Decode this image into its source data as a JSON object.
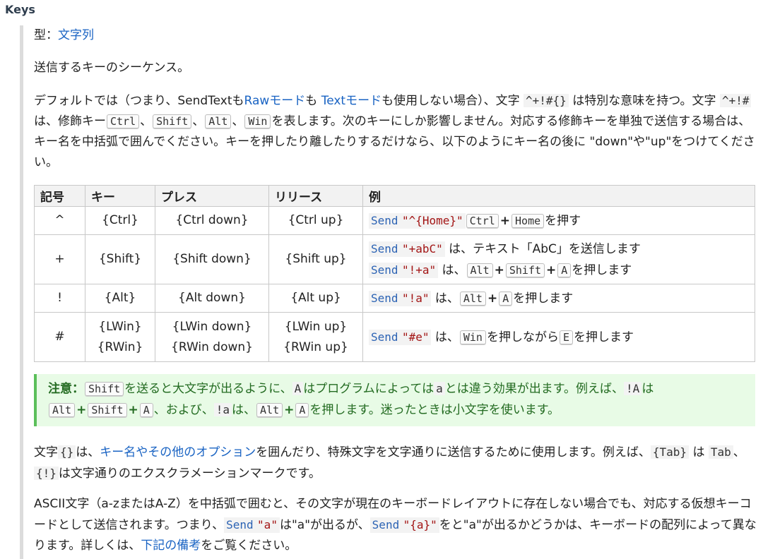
{
  "title": "Keys",
  "type_label": "型：",
  "type_value": "文字列",
  "description": "送信するキーのシーケンス。",
  "para1": {
    "t1": "デフォルトでは（つまり、SendTextも",
    "link_raw": "Rawモード",
    "t2": "も ",
    "link_text": "Textモード",
    "t3": "も使用しない場合）、文字 ",
    "code1": "^+!#{}",
    "t4": " は特別な意味を持つ。文字 ",
    "code2": "^+!#",
    "t5": " は、修飾キー",
    "k_ctrl": "Ctrl",
    "sep1": "、",
    "k_shift": "Shift",
    "sep2": "、",
    "k_alt": "Alt",
    "sep3": "、",
    "k_win": "Win",
    "t6": "を表します。次のキーにしか影響しません。対応する修飾キーを単独で送信する場合は、キー名を中括弧で囲んでください。キーを押したり離したりするだけなら、以下のようにキー名の後に \"down\"や\"up\"をつけてください。"
  },
  "table": {
    "headers": [
      "記号",
      "キー",
      "プレス",
      "リリース",
      "例"
    ],
    "rows": [
      {
        "sym": "^",
        "key": "{Ctrl}",
        "press": "{Ctrl down}",
        "release": "{Ctrl up}"
      },
      {
        "sym": "+",
        "key": "{Shift}",
        "press": "{Shift down}",
        "release": "{Shift up}"
      },
      {
        "sym": "!",
        "key": "{Alt}",
        "press": "{Alt down}",
        "release": "{Alt up}"
      },
      {
        "sym": "#",
        "key": "{LWin}",
        "key2": "{RWin}",
        "press": "{LWin down}",
        "press2": "{RWin down}",
        "release": "{LWin up}",
        "release2": "{RWin up}"
      }
    ],
    "ex_send": "Send",
    "ex1_str": "\"^{Home}\"",
    "ex1_k1": "Ctrl",
    "ex1_k2": "Home",
    "ex1_t": "を押す",
    "ex2a_str": "\"+abC\"",
    "ex2a_t": " は、テキスト「AbC」を送信します",
    "ex2b_str": "\"!+a\"",
    "ex2b_t1": " は、",
    "ex2b_k1": "Alt",
    "ex2b_k2": "Shift",
    "ex2b_k3": "A",
    "ex2b_t2": "を押します",
    "ex3_str": "\"!a\"",
    "ex3_t1": " は、",
    "ex3_k1": "Alt",
    "ex3_k2": "A",
    "ex3_t2": "を押します",
    "ex4_str": "\"#e\"",
    "ex4_t1": " は、",
    "ex4_k1": "Win",
    "ex4_t2": "を押しながら",
    "ex4_k2": "E",
    "ex4_t3": "を押します",
    "plus": "+"
  },
  "note": {
    "label": "注意：",
    "k_shift": "Shift",
    "t1": "を送ると大文字が出るように、",
    "c_A": "A",
    "t2": "はプログラムによっては",
    "c_a": "a",
    "t3": "とは違う効果が出ます。例えば、",
    "c_bangA": "!A",
    "t4": "は",
    "k_alt": "Alt",
    "k_shift2": "Shift",
    "k_A": "A",
    "t5": "、および、",
    "c_banga": "!a",
    "t6": "は、",
    "k_alt2": "Alt",
    "k_A2": "A",
    "t7": "を押します。迷ったときは小文字を使います。"
  },
  "para3": {
    "t1": "文字",
    "code1": "{}",
    "t2": "は、",
    "link": "キー名やその他のオプション",
    "t3": "を囲んだり、特殊文字を文字通りに送信するために使用します。例えば、",
    "code2": "{Tab}",
    "t4": " は ",
    "code3": "Tab",
    "t5": "、",
    "code4": "{!}",
    "t6": "は文字通りのエクスクラメーションマークです。"
  },
  "para4": {
    "t1": "ASCII文字（a-zまたはA-Z）を中括弧で囲むと、その文字が現在のキーボードレイアウトに存在しない場合でも、対応する仮想キーコードとして送信されます。つまり、",
    "send1": "Send",
    "str1": "\"a\"",
    "t2": "は\"a\"が出るが、",
    "send2": "Send",
    "str2": "\"{a}\"",
    "t3": "をと\"a\"が出るかどうかは、キーボードの配列によって異なります。詳しくは、",
    "link": "下記の備考",
    "t4": "をご覧ください。"
  }
}
